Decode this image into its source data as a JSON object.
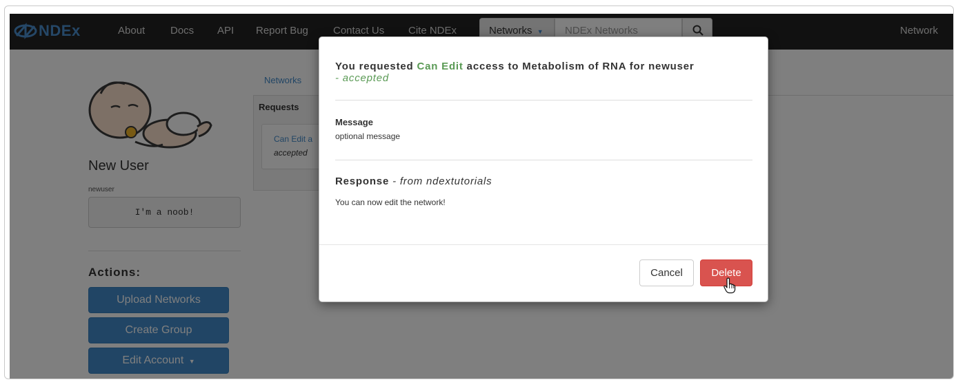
{
  "navbar": {
    "logo_text": "NDEx",
    "links": [
      "About",
      "Docs",
      "API",
      "Report Bug",
      "Contact Us",
      "Cite NDEx"
    ],
    "search_scope": "Networks",
    "search_placeholder": "NDEx Networks",
    "right_link": "Network"
  },
  "profile": {
    "name": "New User",
    "handle": "newuser",
    "bio": "I'm a noob!",
    "actions_title": "Actions:",
    "actions": [
      "Upload Networks",
      "Create Group",
      "Edit Account"
    ]
  },
  "main": {
    "tab_link": "Networks",
    "panel_tab": "Requests",
    "request_line1": "Can Edit a",
    "request_line2": "accepted"
  },
  "modal": {
    "title_prefix": "You requested",
    "permission": "Can Edit",
    "title_suffix": "access to Metabolism of RNA for newuser",
    "status": "- accepted",
    "message_label": "Message",
    "message_text": "optional message",
    "response_label": "Response",
    "response_from": "- from ndextutorials",
    "response_text": "You can now edit the network!",
    "cancel_label": "Cancel",
    "delete_label": "Delete"
  },
  "colors": {
    "navbar": "#222222",
    "primary": "#428bca",
    "danger": "#d9534f",
    "accent_green": "#5a9a55"
  }
}
